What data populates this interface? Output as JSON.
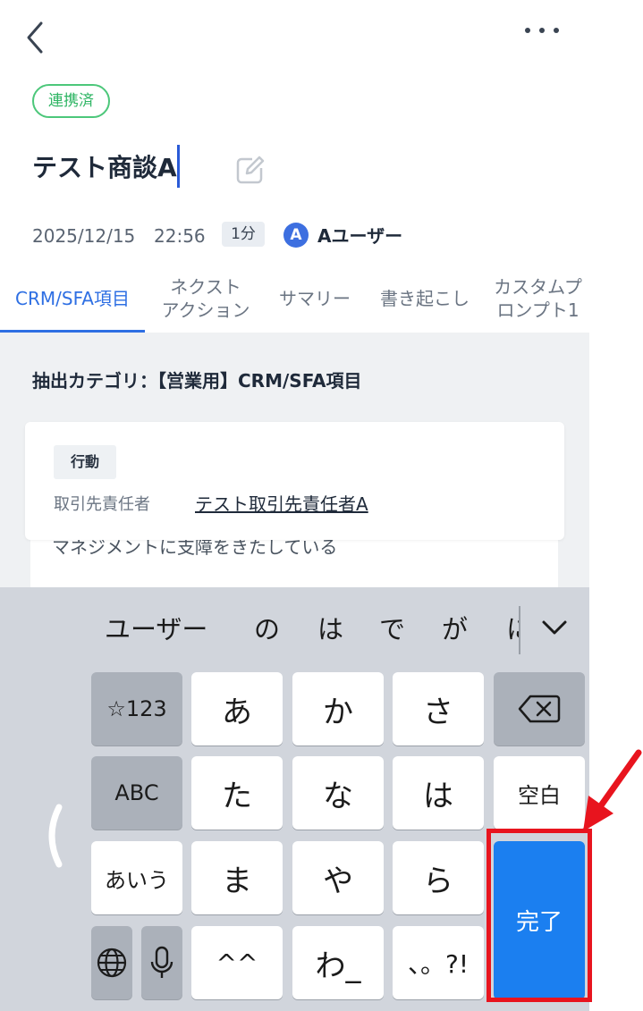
{
  "header": {
    "status_badge": "連携済",
    "title": "テスト商談A",
    "date": "2025/12/15",
    "time": "22:56",
    "duration": "1分",
    "avatar_initial": "A",
    "user_name": "Aユーザー"
  },
  "tabs": [
    {
      "label": "CRM/SFA項目",
      "active": true
    },
    {
      "label": "ネクスト\nアクション",
      "active": false
    },
    {
      "label": "サマリー",
      "active": false
    },
    {
      "label": "書き起こし",
      "active": false
    },
    {
      "label": "カスタムプ\nロンプト1",
      "active": false
    }
  ],
  "content": {
    "category_label": "抽出カテゴリ：【営業用】CRM/SFA項目",
    "card": {
      "chip": "行動",
      "field_label": "取引先責任者",
      "field_value": "テスト取引先責任者A"
    },
    "behind_text": "マネジメントに支障をきたしている"
  },
  "keyboard": {
    "suggestions": [
      "ユーザー",
      "の",
      "は",
      "で",
      "が",
      "に"
    ],
    "keys": {
      "sym": "☆123",
      "abc": "ABC",
      "kana_mode": "あいう",
      "a": "あ",
      "ka": "か",
      "sa": "さ",
      "ta": "た",
      "na": "な",
      "ha": "は",
      "ma": "ま",
      "ya": "や",
      "ra": "ら",
      "dakuten": "^^",
      "wa": "わ_",
      "punct": "、。?!",
      "space": "空白",
      "done": "完了"
    }
  },
  "colors": {
    "accent": "#2e6fe3",
    "badge_green": "#4cc77a",
    "done_key": "#1b7ff0",
    "highlight": "#e8141e"
  }
}
